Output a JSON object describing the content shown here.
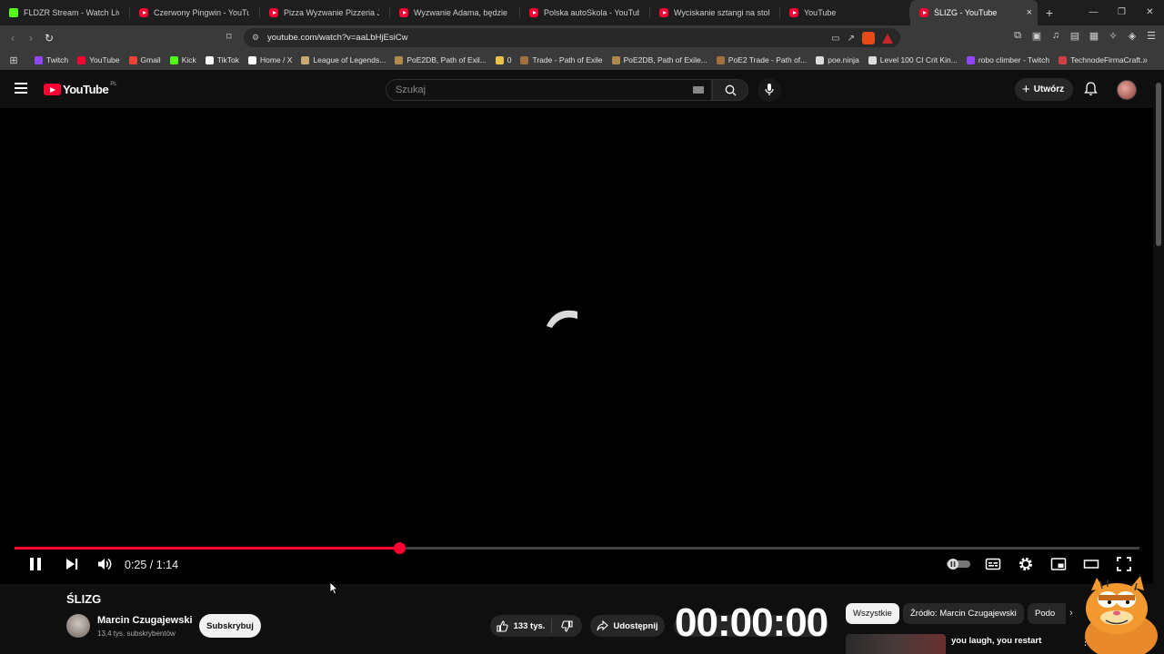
{
  "browser": {
    "tabs": [
      {
        "title": "FLDZR Stream - Watch Live on",
        "icon": "kick-icon",
        "active": false
      },
      {
        "title": "Czerwony Pingwin - YouTube",
        "icon": "youtube-icon",
        "active": false
      },
      {
        "title": "Pizza Wyzwanie Pizzeria JOLAN",
        "icon": "youtube-icon",
        "active": false
      },
      {
        "title": "Wyzwanie Adama, będzie reko",
        "icon": "youtube-icon",
        "active": false
      },
      {
        "title": "Polska autoSkola - YouTube",
        "icon": "youtube-icon",
        "active": false
      },
      {
        "title": "Wyciskanie sztangi na stole FA",
        "icon": "youtube-icon",
        "active": false
      },
      {
        "title": "YouTube",
        "icon": "youtube-icon",
        "active": false
      },
      {
        "title": "ŚLIZG - YouTube",
        "icon": "youtube-icon",
        "active": true
      }
    ],
    "new_tab": "+",
    "close_tab": "×",
    "url": "youtube.com/watch?v=aaLbHjEsiCw",
    "shield_badge_count": "1",
    "bookmarks": [
      {
        "label": "Twitch",
        "color": "#9146ff"
      },
      {
        "label": "YouTube",
        "color": "#ff0033"
      },
      {
        "label": "Gmail",
        "color": "#ea4335"
      },
      {
        "label": "Kick",
        "color": "#53fc18"
      },
      {
        "label": "TikTok",
        "color": "#ffffff"
      },
      {
        "label": "Home / X",
        "color": "#ffffff"
      },
      {
        "label": "League of Legends...",
        "color": "#c8aa6e"
      },
      {
        "label": "PoE2DB, Path of Exil...",
        "color": "#b08a4a"
      },
      {
        "label": "0",
        "color": "#e8c24a"
      },
      {
        "label": "Trade - Path of Exile",
        "color": "#a07040"
      },
      {
        "label": "PoE2DB, Path of Exile...",
        "color": "#b08a4a"
      },
      {
        "label": "PoE2 Trade - Path of...",
        "color": "#a07040"
      },
      {
        "label": "poe.ninja",
        "color": "#dddddd"
      },
      {
        "label": "Level 100 CI Crit Kin...",
        "color": "#dddddd"
      },
      {
        "label": "robo climber - Twitch",
        "color": "#9146ff"
      },
      {
        "label": "TechnodeFirmaCraft...",
        "color": "#d04040"
      }
    ],
    "bookmarks_more": "»"
  },
  "youtube": {
    "logo_text": "YouTube",
    "logo_region": "PL",
    "search_placeholder": "Szukaj",
    "create_label": "Utwórz",
    "player": {
      "current_time": "0:25",
      "duration": "1:14",
      "time_display": "0:25 / 1:14",
      "progress_fraction": 0.342,
      "loading": true
    },
    "video": {
      "title": "ŚLIZG",
      "channel": "Marcin Czugajewski",
      "subscribers": "13,4 tys. subskrybentów",
      "subscribe_label": "Subskrybuj",
      "likes": "133 tys.",
      "share_label": "Udostępnij"
    },
    "overlay_timer": "00:00:00",
    "chips": [
      "Wszystkie",
      "Źródło: Marcin Czugajewski",
      "Podo"
    ],
    "recommended": [
      {
        "title": "you laugh, you restart"
      }
    ]
  },
  "colors": {
    "brand_red": "#ff0033",
    "background": "#0f0f0f",
    "chrome": "#3a3a3a"
  }
}
